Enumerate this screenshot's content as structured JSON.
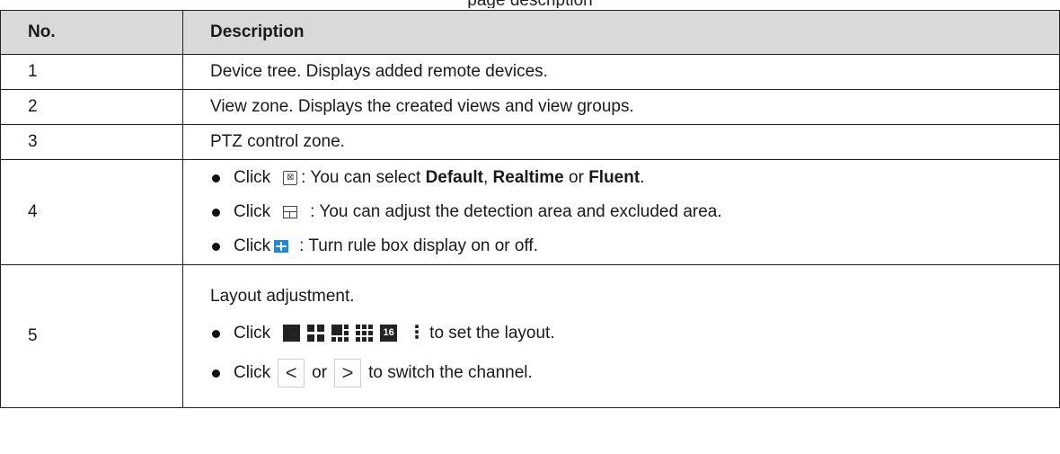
{
  "caption": "page description",
  "table": {
    "headers": {
      "no": "No.",
      "description": "Description"
    },
    "rows": [
      {
        "no": "1",
        "text": "Device tree. Displays added remote devices."
      },
      {
        "no": "2",
        "text": "View zone. Displays the created views and view groups."
      },
      {
        "no": "3",
        "text": "PTZ control zone."
      },
      {
        "no": "4",
        "bullets": [
          {
            "click": "Click",
            "pre": ": You can select ",
            "kw1": "Default",
            "sep1": ", ",
            "kw2": "Realtime",
            "sep2": " or ",
            "kw3": "Fluent",
            "end": ".",
            "icon": "stream-type-icon"
          },
          {
            "click": "Click",
            "text": ": You can adjust the detection area and excluded area.",
            "icon": "detection-area-icon"
          },
          {
            "click": "Click",
            "text": ": Turn rule box display on or off.",
            "icon": "rule-box-icon",
            "icon_color": "#1e88e5"
          }
        ]
      },
      {
        "no": "5",
        "intro": "Layout adjustment.",
        "bullets": [
          {
            "click": "Click",
            "text": "to set the layout.",
            "icons": [
              "layout-1-icon",
              "layout-4-icon",
              "layout-6-icon",
              "layout-9-icon",
              "layout-16-icon",
              "more-icon"
            ],
            "layout16_label": "16",
            "more_label": "⋮"
          },
          {
            "click": "Click",
            "or": "or",
            "text": "to switch the channel.",
            "prev_label": "<",
            "next_label": ">"
          }
        ]
      }
    ]
  }
}
